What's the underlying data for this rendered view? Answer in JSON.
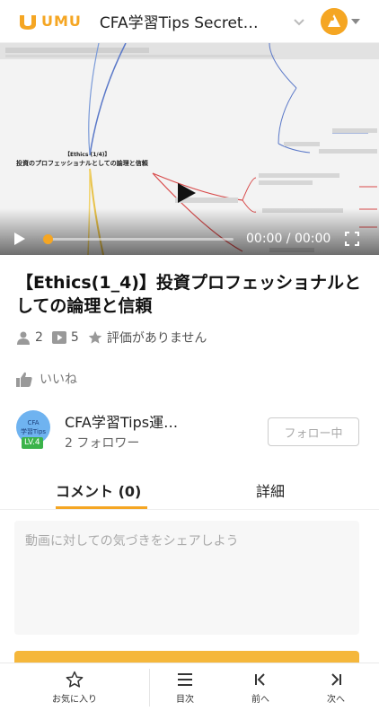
{
  "header": {
    "logo_text": "UMU",
    "title": "CFA学習Tips Secret…",
    "brand_color": "#f5a623"
  },
  "video": {
    "slide_heading_line1": "【Ethics (1/4)】",
    "slide_heading_line2": "投資のプロフェッショナルとしての論理と信頼",
    "time_display": "00:00 / 00:00",
    "progress": 0
  },
  "lecture": {
    "title": "【Ethics(1_4)】投資プロフェッショナルとしての論理と信頼"
  },
  "stats": {
    "participants": "2",
    "videos": "5",
    "rating": "評価がありません"
  },
  "like": {
    "label": "いいね"
  },
  "author": {
    "avatar_line1": "CFA",
    "avatar_line2": "学習Tips",
    "level": "LV.4",
    "name": "CFA学習Tips運…",
    "followers": "2 フォロワー",
    "follow_button": "フォロー中"
  },
  "tabs": {
    "comments": "コメント (0)",
    "details": "詳細"
  },
  "comment": {
    "placeholder": "動画に対しての気づきをシェアしよう"
  },
  "bottom_bar": {
    "favorite": "お気に入り",
    "toc": "目次",
    "prev": "前へ",
    "next": "次へ"
  }
}
